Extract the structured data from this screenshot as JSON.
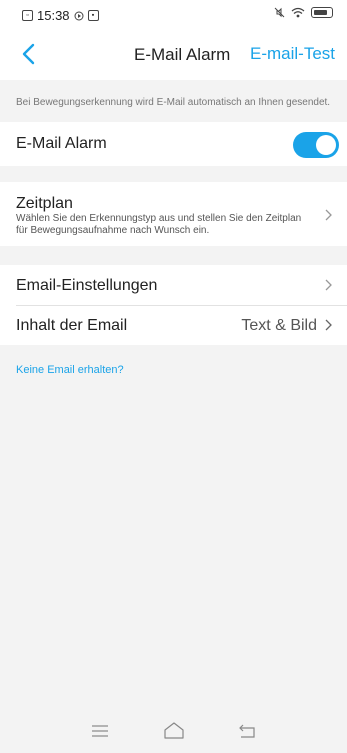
{
  "status_bar": {
    "time": "15:38",
    "left_icons": [
      "notification-icon",
      "play-icon",
      "sim-icon"
    ],
    "right_icons": [
      "mute-icon",
      "wifi-icon",
      "battery-icon"
    ]
  },
  "header": {
    "title": "E-Mail Alarm",
    "action_label": "E-mail-Test",
    "accent_color": "#1aa3e8"
  },
  "hint_text": "Bei Bewegungserkennung wird E-Mail automatisch an Ihnen gesendet.",
  "email_alarm": {
    "label": "E-Mail Alarm",
    "enabled": true
  },
  "schedule": {
    "title": "Zeitplan",
    "description": "Wählen Sie den Erkennungstyp aus und stellen Sie den Zeitplan für Bewegungsaufnahme nach Wunsch ein."
  },
  "email_settings": {
    "label": "Email-Einstellungen"
  },
  "email_content": {
    "label": "Inhalt der Email",
    "value": "Text & Bild"
  },
  "help_link": "Keine Email erhalten?",
  "nav_bar": [
    "menu-icon",
    "home-icon",
    "back-icon"
  ]
}
